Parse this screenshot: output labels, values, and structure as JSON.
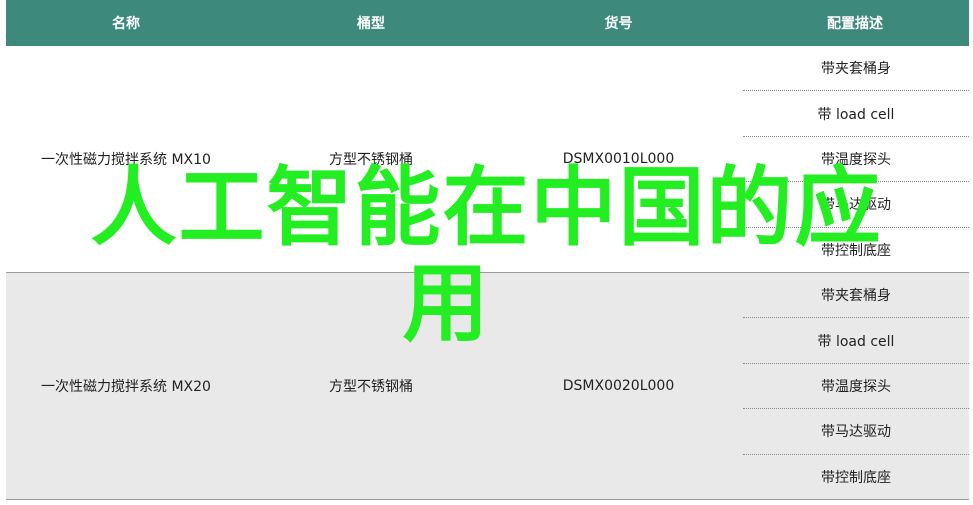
{
  "headers": [
    "名称",
    "桶型",
    "货号",
    "配置描述"
  ],
  "rows": [
    {
      "name": "一次性磁力搅拌系统 MX10",
      "type": "方型不锈钢桶",
      "code": "DSMX0010L000",
      "features": [
        "带夹套桶身",
        "带 load cell",
        "带温度探头",
        "带马达驱动",
        "带控制底座"
      ]
    },
    {
      "name": "一次性磁力搅拌系统 MX20",
      "type": "方型不锈钢桶",
      "code": "DSMX0020L000",
      "features": [
        "带夹套桶身",
        "带 load cell",
        "带温度探头",
        "带马达驱动",
        "带控制底座"
      ]
    }
  ],
  "overlay": {
    "line1": "人工智能在中国的应",
    "line2": "用"
  },
  "colors": {
    "header_bg": "#3d8a7d",
    "overlay_text": "#22ee22",
    "alt_row_bg": "#e9e9e9"
  }
}
